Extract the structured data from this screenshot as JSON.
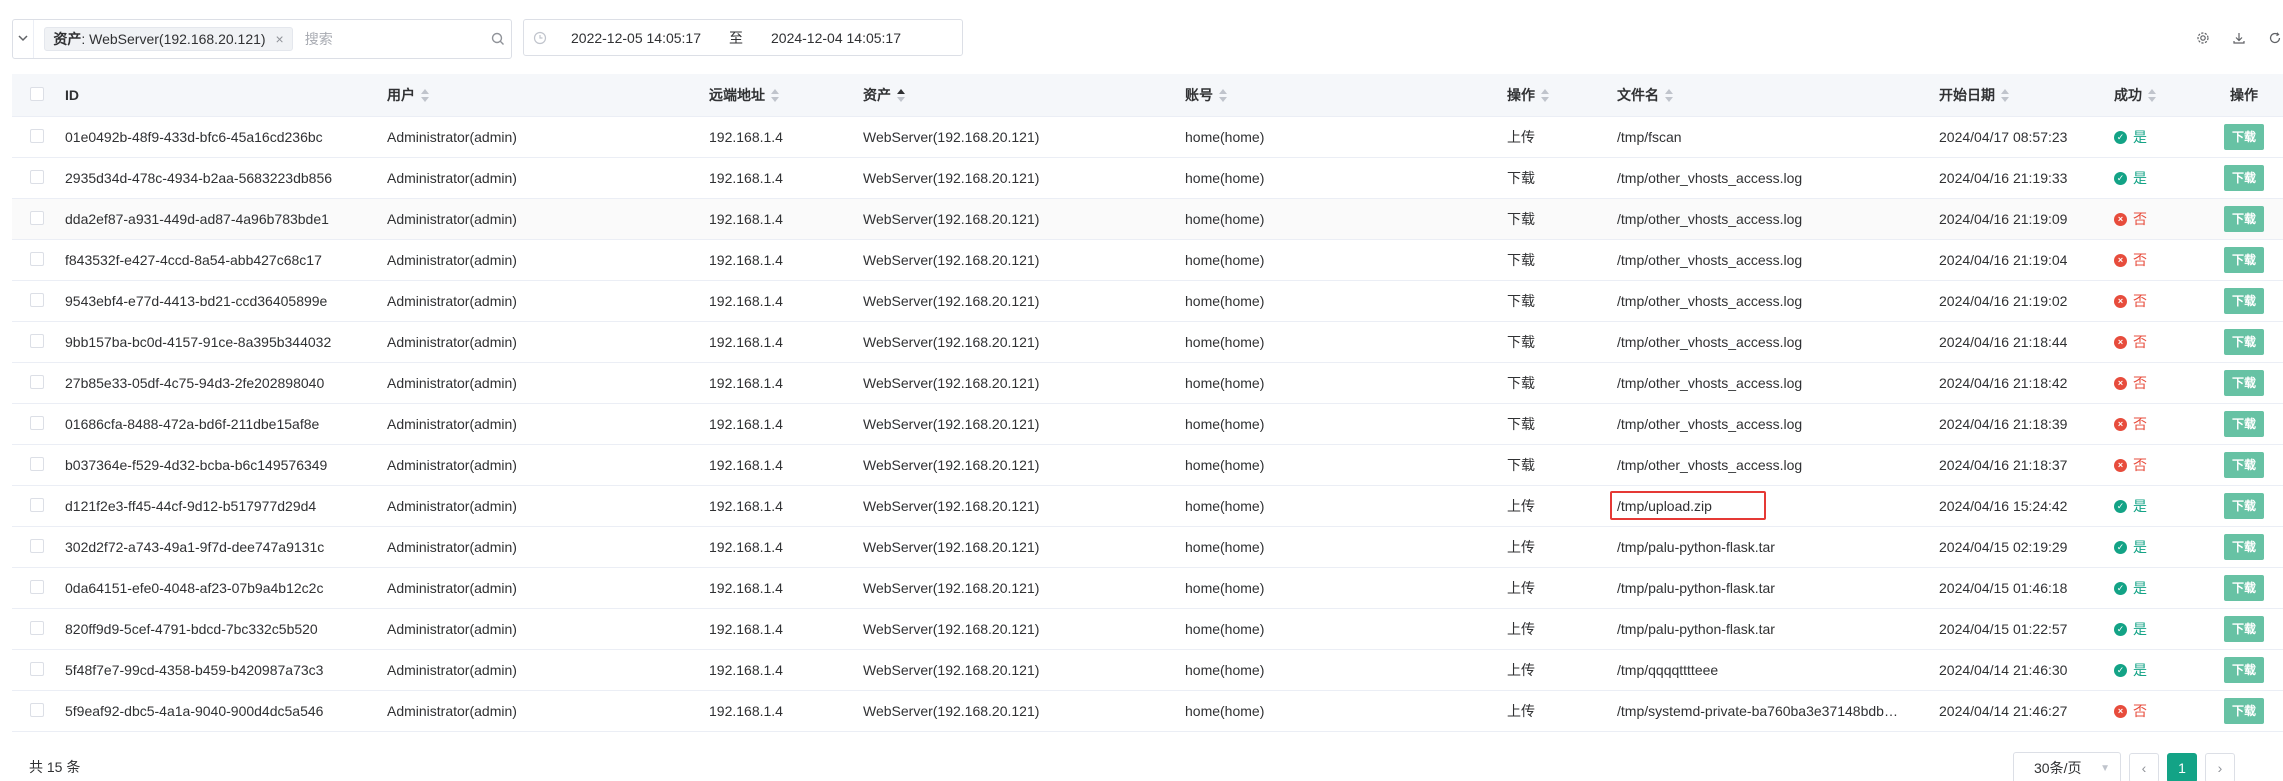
{
  "filter": {
    "chip_key": "资产",
    "chip_value": ": WebServer(192.168.20.121)",
    "chip_close": "×",
    "search_placeholder": "搜索",
    "date_start": "2022-12-05 14:05:17",
    "date_separator": "至",
    "date_end": "2024-12-04 14:05:17"
  },
  "top_actions": {
    "icons": [
      "settings-icon",
      "download-icon",
      "refresh-icon"
    ]
  },
  "table": {
    "columns": {
      "id": "ID",
      "user": "用户",
      "remote": "远端地址",
      "asset": "资产",
      "account": "账号",
      "operation": "操作",
      "filename": "文件名",
      "start_date": "开始日期",
      "success": "成功",
      "actions": "操作"
    },
    "action_label": "下载",
    "rows": [
      {
        "id": "01e0492b-48f9-433d-bfc6-45a16cd236bc",
        "user": "Administrator(admin)",
        "remote": "192.168.1.4",
        "asset": "WebServer(192.168.20.121)",
        "account": "home(home)",
        "op": "上传",
        "file": "/tmp/fscan",
        "date": "2024/04/17 08:57:23",
        "ok": "是",
        "ok_icon": "✓"
      },
      {
        "id": "2935d34d-478c-4934-b2aa-5683223db856",
        "user": "Administrator(admin)",
        "remote": "192.168.1.4",
        "asset": "WebServer(192.168.20.121)",
        "account": "home(home)",
        "op": "下载",
        "file": "/tmp/other_vhosts_access.log",
        "date": "2024/04/16 21:19:33",
        "ok": "是",
        "ok_icon": "✓"
      },
      {
        "id": "dda2ef87-a931-449d-ad87-4a96b783bde1",
        "user": "Administrator(admin)",
        "remote": "192.168.1.4",
        "asset": "WebServer(192.168.20.121)",
        "account": "home(home)",
        "op": "下载",
        "file": "/tmp/other_vhosts_access.log",
        "date": "2024/04/16 21:19:09",
        "ok": "否",
        "ok_icon": "×"
      },
      {
        "id": "f843532f-e427-4ccd-8a54-abb427c68c17",
        "user": "Administrator(admin)",
        "remote": "192.168.1.4",
        "asset": "WebServer(192.168.20.121)",
        "account": "home(home)",
        "op": "下载",
        "file": "/tmp/other_vhosts_access.log",
        "date": "2024/04/16 21:19:04",
        "ok": "否",
        "ok_icon": "×"
      },
      {
        "id": "9543ebf4-e77d-4413-bd21-ccd36405899e",
        "user": "Administrator(admin)",
        "remote": "192.168.1.4",
        "asset": "WebServer(192.168.20.121)",
        "account": "home(home)",
        "op": "下载",
        "file": "/tmp/other_vhosts_access.log",
        "date": "2024/04/16 21:19:02",
        "ok": "否",
        "ok_icon": "×"
      },
      {
        "id": "9bb157ba-bc0d-4157-91ce-8a395b344032",
        "user": "Administrator(admin)",
        "remote": "192.168.1.4",
        "asset": "WebServer(192.168.20.121)",
        "account": "home(home)",
        "op": "下载",
        "file": "/tmp/other_vhosts_access.log",
        "date": "2024/04/16 21:18:44",
        "ok": "否",
        "ok_icon": "×"
      },
      {
        "id": "27b85e33-05df-4c75-94d3-2fe202898040",
        "user": "Administrator(admin)",
        "remote": "192.168.1.4",
        "asset": "WebServer(192.168.20.121)",
        "account": "home(home)",
        "op": "下载",
        "file": "/tmp/other_vhosts_access.log",
        "date": "2024/04/16 21:18:42",
        "ok": "否",
        "ok_icon": "×"
      },
      {
        "id": "01686cfa-8488-472a-bd6f-211dbe15af8e",
        "user": "Administrator(admin)",
        "remote": "192.168.1.4",
        "asset": "WebServer(192.168.20.121)",
        "account": "home(home)",
        "op": "下载",
        "file": "/tmp/other_vhosts_access.log",
        "date": "2024/04/16 21:18:39",
        "ok": "否",
        "ok_icon": "×"
      },
      {
        "id": "b037364e-f529-4d32-bcba-b6c149576349",
        "user": "Administrator(admin)",
        "remote": "192.168.1.4",
        "asset": "WebServer(192.168.20.121)",
        "account": "home(home)",
        "op": "下载",
        "file": "/tmp/other_vhosts_access.log",
        "date": "2024/04/16 21:18:37",
        "ok": "否",
        "ok_icon": "×"
      },
      {
        "id": "d121f2e3-ff45-44cf-9d12-b517977d29d4",
        "user": "Administrator(admin)",
        "remote": "192.168.1.4",
        "asset": "WebServer(192.168.20.121)",
        "account": "home(home)",
        "op": "上传",
        "file": "/tmp/upload.zip",
        "date": "2024/04/16 15:24:42",
        "ok": "是",
        "ok_icon": "✓"
      },
      {
        "id": "302d2f72-a743-49a1-9f7d-dee747a9131c",
        "user": "Administrator(admin)",
        "remote": "192.168.1.4",
        "asset": "WebServer(192.168.20.121)",
        "account": "home(home)",
        "op": "上传",
        "file": "/tmp/palu-python-flask.tar",
        "date": "2024/04/15 02:19:29",
        "ok": "是",
        "ok_icon": "✓"
      },
      {
        "id": "0da64151-efe0-4048-af23-07b9a4b12c2c",
        "user": "Administrator(admin)",
        "remote": "192.168.1.4",
        "asset": "WebServer(192.168.20.121)",
        "account": "home(home)",
        "op": "上传",
        "file": "/tmp/palu-python-flask.tar",
        "date": "2024/04/15 01:46:18",
        "ok": "是",
        "ok_icon": "✓"
      },
      {
        "id": "820ff9d9-5cef-4791-bdcd-7bc332c5b520",
        "user": "Administrator(admin)",
        "remote": "192.168.1.4",
        "asset": "WebServer(192.168.20.121)",
        "account": "home(home)",
        "op": "上传",
        "file": "/tmp/palu-python-flask.tar",
        "date": "2024/04/15 01:22:57",
        "ok": "是",
        "ok_icon": "✓"
      },
      {
        "id": "5f48f7e7-99cd-4358-b459-b420987a73c3",
        "user": "Administrator(admin)",
        "remote": "192.168.1.4",
        "asset": "WebServer(192.168.20.121)",
        "account": "home(home)",
        "op": "上传",
        "file": "/tmp/qqqqtttteee",
        "date": "2024/04/14 21:46:30",
        "ok": "是",
        "ok_icon": "✓"
      },
      {
        "id": "5f9eaf92-dbc5-4a1a-9040-900d4dc5a546",
        "user": "Administrator(admin)",
        "remote": "192.168.1.4",
        "asset": "WebServer(192.168.20.121)",
        "account": "home(home)",
        "op": "上传",
        "file": "/tmp/systemd-private-ba760ba3e37148bdb…",
        "date": "2024/04/14 21:46:27",
        "ok": "否",
        "ok_icon": "×"
      }
    ]
  },
  "footer": {
    "total_text": "共 15 条",
    "page_size": "30条/页",
    "current_page": "1",
    "prev": "‹",
    "next": "›"
  },
  "colors": {
    "accent": "#13a386",
    "success": "#13a386",
    "fail": "#e74c3c",
    "download_button": "#67c2a4",
    "highlight": "#e53935"
  }
}
